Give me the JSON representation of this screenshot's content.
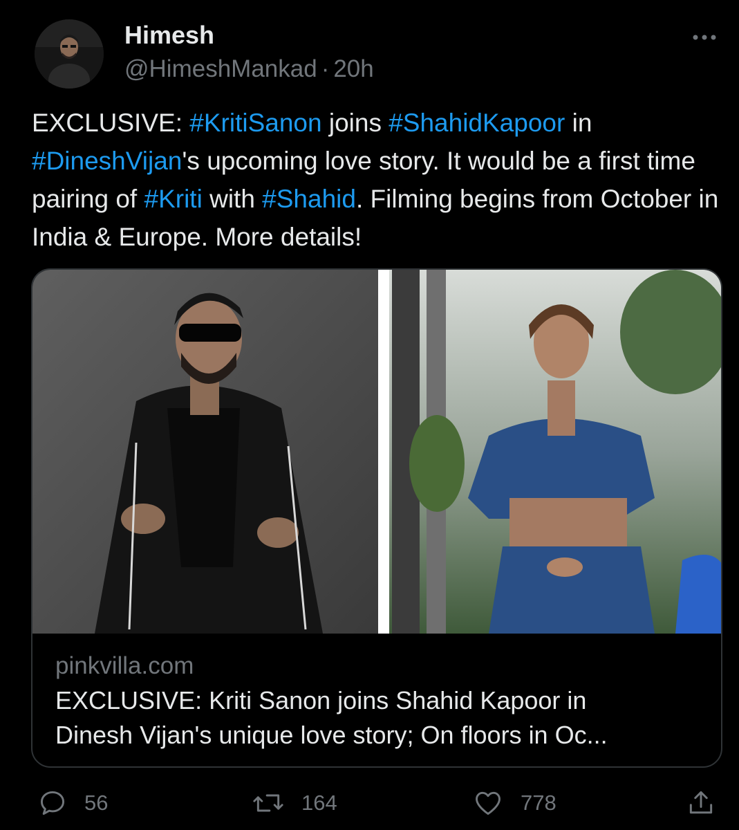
{
  "author": {
    "name": "Himesh",
    "handle": "@HimeshMankad",
    "separator": "·",
    "time": "20h"
  },
  "tweet": {
    "segments": [
      {
        "text": "EXCLUSIVE: ",
        "hashtag": false
      },
      {
        "text": "#KritiSanon",
        "hashtag": true
      },
      {
        "text": " joins ",
        "hashtag": false
      },
      {
        "text": "#ShahidKapoor",
        "hashtag": true
      },
      {
        "text": " in ",
        "hashtag": false
      },
      {
        "text": "#DineshVijan",
        "hashtag": true
      },
      {
        "text": "'s upcoming love story. It would be a first time pairing of ",
        "hashtag": false
      },
      {
        "text": "#Kriti",
        "hashtag": true
      },
      {
        "text": " with ",
        "hashtag": false
      },
      {
        "text": "#Shahid",
        "hashtag": true
      },
      {
        "text": ". Filming begins from October in India & Europe. More details!",
        "hashtag": false
      }
    ]
  },
  "card": {
    "domain": "pinkvilla.com",
    "title_line1": "EXCLUSIVE: Kriti Sanon joins Shahid Kapoor in",
    "title_line2": "Dinesh Vijan's unique love story; On floors in Oc..."
  },
  "actions": {
    "replies": "56",
    "retweets": "164",
    "likes": "778"
  },
  "icons": {
    "more": "more-icon",
    "reply": "reply-icon",
    "retweet": "retweet-icon",
    "like": "heart-icon",
    "share": "share-icon"
  },
  "colors": {
    "background": "#000000",
    "text": "#e7e9ea",
    "secondary": "#71767b",
    "hashtag": "#1d9bf0",
    "border": "#2f3336"
  }
}
